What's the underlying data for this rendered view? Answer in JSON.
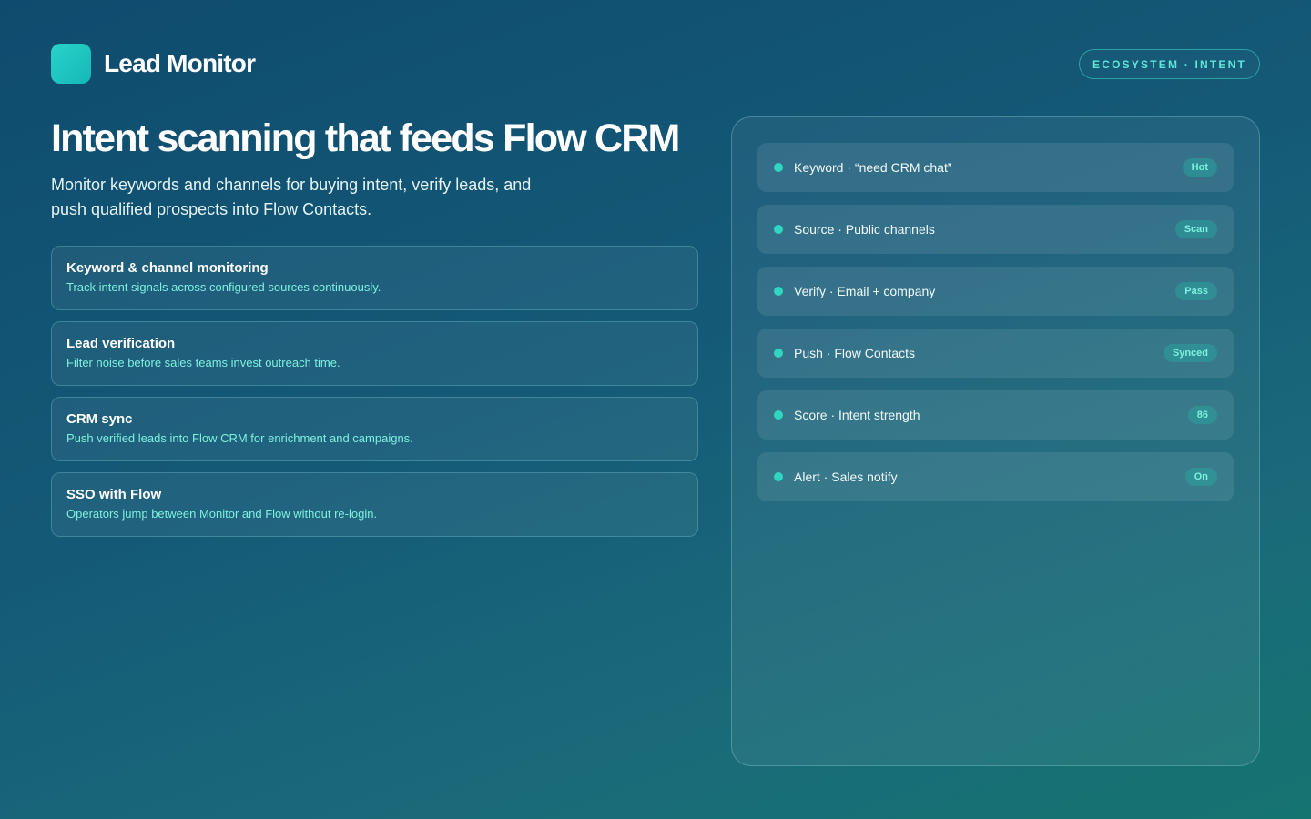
{
  "header": {
    "brand": "Lead Monitor",
    "tag": "ECOSYSTEM · INTENT"
  },
  "hero": {
    "title": "Intent scanning that feeds Flow CRM",
    "subtitle": "Monitor keywords and channels for buying intent, verify leads, and push qualified prospects into Flow Contacts."
  },
  "features": [
    {
      "title": "Keyword & channel monitoring",
      "desc": "Track intent signals across configured sources continuously."
    },
    {
      "title": "Lead verification",
      "desc": "Filter noise before sales teams invest outreach time."
    },
    {
      "title": "CRM sync",
      "desc": "Push verified leads into Flow CRM for enrichment and campaigns."
    },
    {
      "title": "SSO with Flow",
      "desc": "Operators jump between Monitor and Flow without re-login."
    }
  ],
  "pipeline": [
    {
      "label": "Keyword · “need CRM chat”",
      "badge": "Hot"
    },
    {
      "label": "Source · Public channels",
      "badge": "Scan"
    },
    {
      "label": "Verify · Email + company",
      "badge": "Pass"
    },
    {
      "label": "Push · Flow Contacts",
      "badge": "Synced"
    },
    {
      "label": "Score · Intent strength",
      "badge": "86"
    },
    {
      "label": "Alert · Sales notify",
      "badge": "On"
    }
  ],
  "colors": {
    "accent": "#2fd6c2",
    "accent_text": "#7ff0df",
    "bg_top": "#0f4b6e",
    "bg_bottom": "#157470"
  },
  "icons": {
    "logo": "logo-mark-icon",
    "status": "status-dot-icon"
  }
}
